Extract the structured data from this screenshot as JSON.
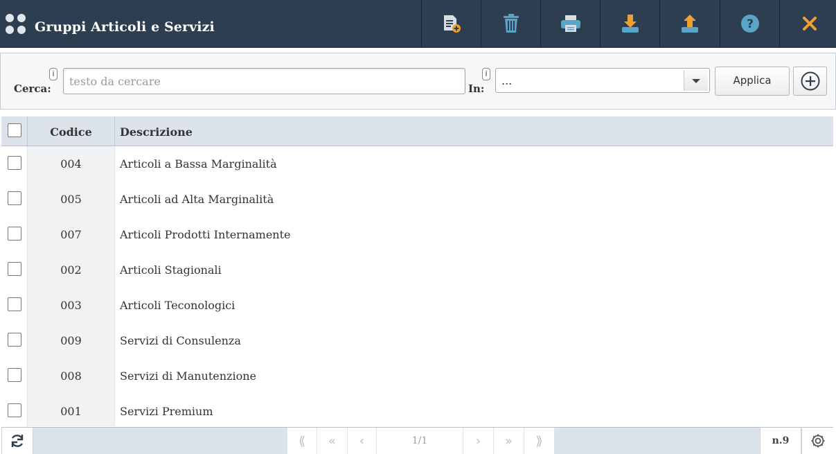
{
  "header": {
    "title": "Gruppi Articoli e Servizi",
    "toolbar": [
      {
        "name": "new-document-button",
        "icon": "new-document-icon"
      },
      {
        "name": "delete-button",
        "icon": "trash-icon"
      },
      {
        "name": "print-button",
        "icon": "printer-icon"
      },
      {
        "name": "download-button",
        "icon": "download-icon"
      },
      {
        "name": "upload-button",
        "icon": "upload-icon"
      },
      {
        "name": "help-button",
        "icon": "help-icon"
      },
      {
        "name": "close-button",
        "icon": "close-icon"
      }
    ]
  },
  "search": {
    "label": "Cerca:",
    "info": "i",
    "placeholder": "testo da cercare",
    "value": "",
    "in_label": "In:",
    "in_value": "...",
    "apply_label": "Applica"
  },
  "table": {
    "columns": [
      "Codice",
      "Descrizione"
    ],
    "rows": [
      {
        "code": "004",
        "desc": "Articoli a Bassa Marginalità"
      },
      {
        "code": "005",
        "desc": "Articoli ad Alta Marginalità"
      },
      {
        "code": "007",
        "desc": "Articoli Prodotti Internamente"
      },
      {
        "code": "002",
        "desc": "Articoli Stagionali"
      },
      {
        "code": "003",
        "desc": "Articoli Teconologici"
      },
      {
        "code": "009",
        "desc": "Servizi di Consulenza"
      },
      {
        "code": "008",
        "desc": "Servizi di Manutenzione"
      },
      {
        "code": "001",
        "desc": "Servizi Premium"
      }
    ]
  },
  "footer": {
    "page": "1/1",
    "count": "n.9"
  },
  "colors": {
    "header_bg": "#2c3e50",
    "icon_teal": "#5ba3c7",
    "icon_doc": "#d8dde3",
    "close_orange": "#f0a030"
  }
}
